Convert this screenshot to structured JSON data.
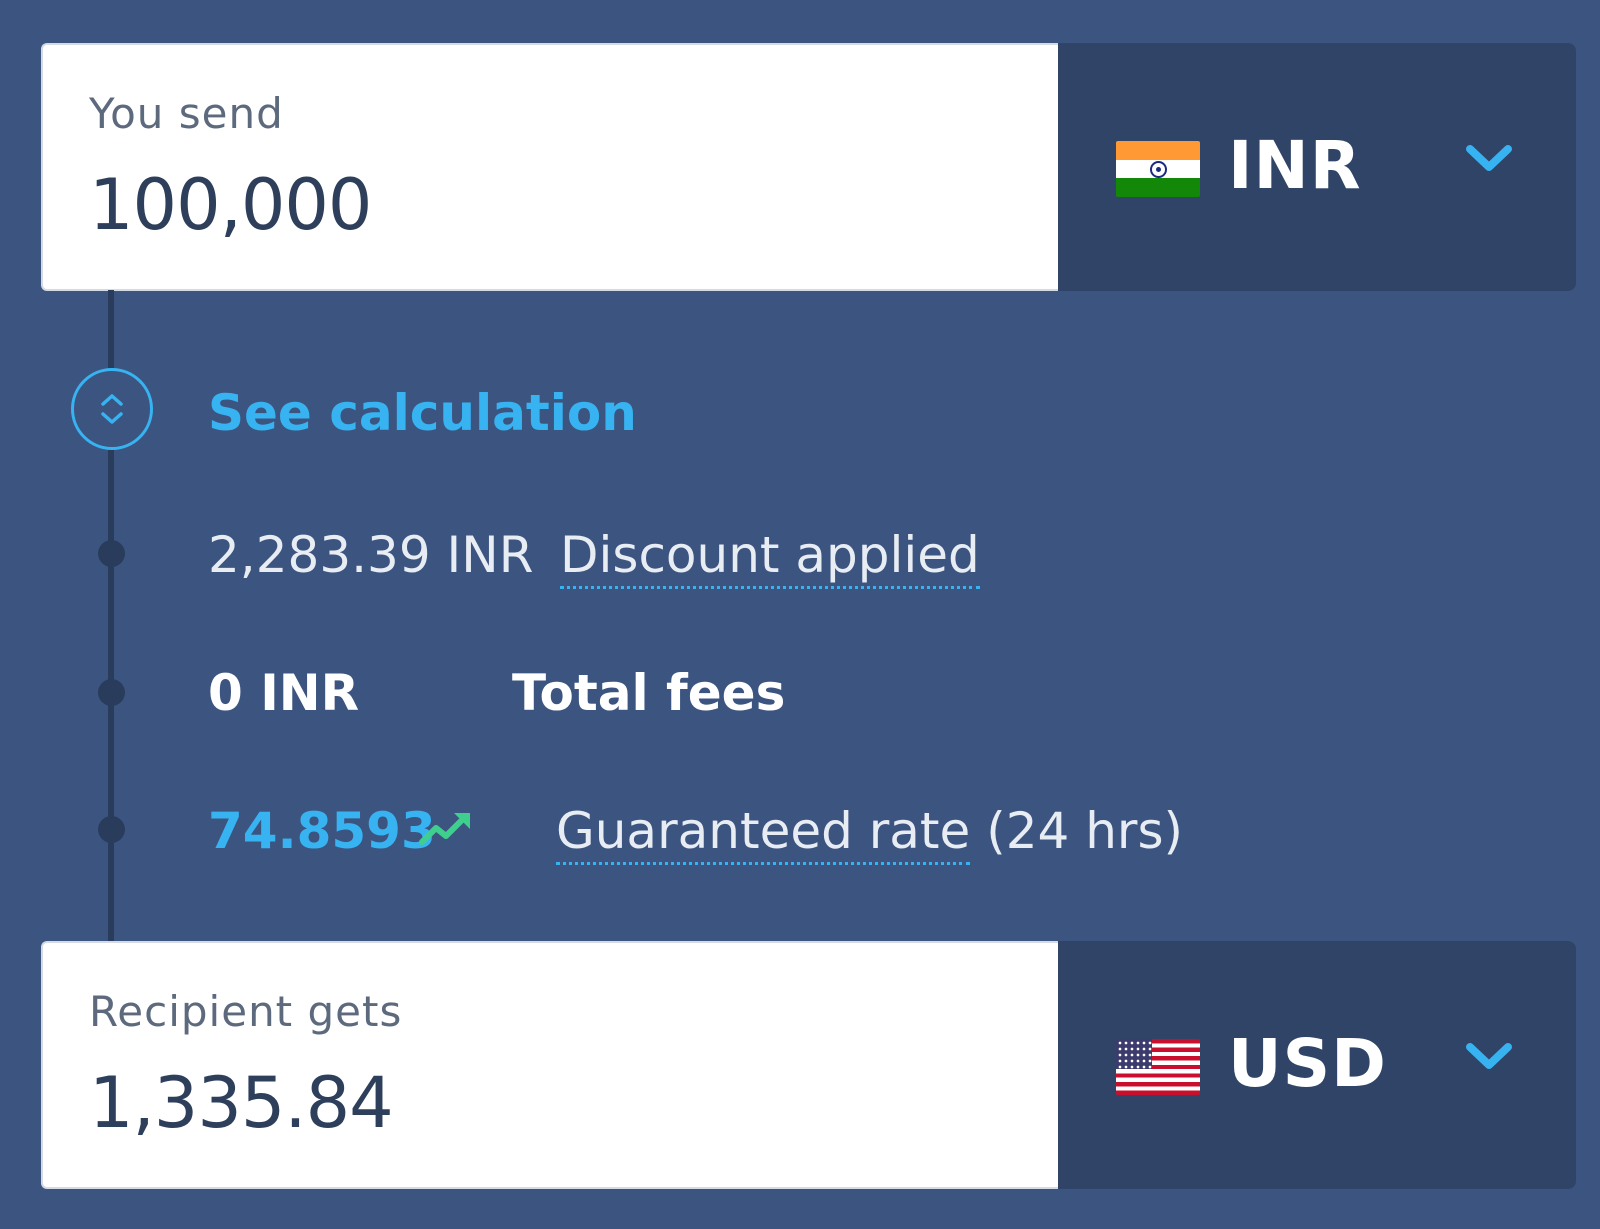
{
  "send": {
    "label": "You send",
    "amount": "100,000",
    "currency": "INR",
    "flag_icon": "india-flag-icon"
  },
  "breakdown": {
    "toggle_label": "See calculation",
    "discount": {
      "amount": "2,283.39 INR",
      "label": "Discount applied"
    },
    "fees": {
      "amount": "0 INR",
      "label": "Total fees"
    },
    "rate": {
      "value": "74.8593",
      "label": "Guaranteed rate",
      "duration": "(24 hrs)",
      "trend_icon": "trend-up-icon"
    }
  },
  "receive": {
    "label": "Recipient gets",
    "amount": "1,335.84",
    "currency": "USD",
    "flag_icon": "usa-flag-icon"
  },
  "colors": {
    "background": "#3c5480",
    "panel": "#2f4466",
    "accent": "#37b3f2",
    "trend_green": "#3ecf8e"
  }
}
